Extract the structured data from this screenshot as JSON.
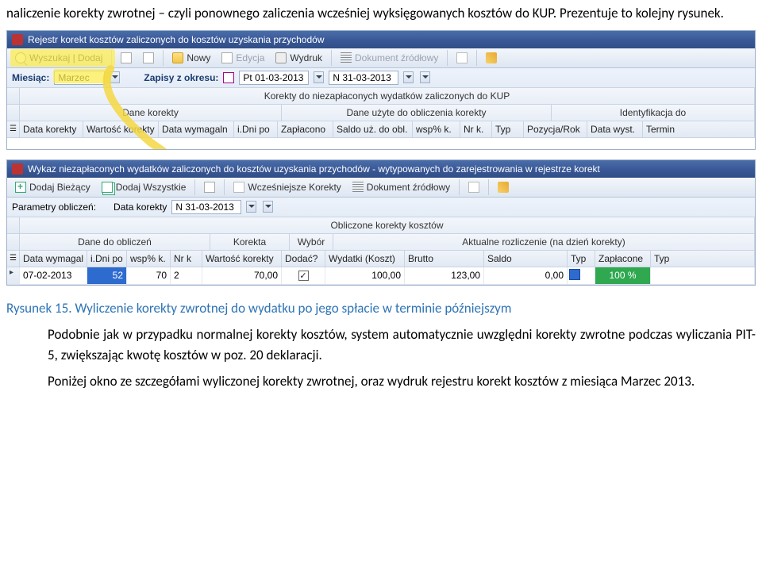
{
  "doc": {
    "para_top": "naliczenie korekty zwrotnej – czyli ponownego zaliczenia wcześniej wyksięgowanych kosztów do KUP. Prezentuje to kolejny rysunek.",
    "caption": "Rysunek 15. Wyliczenie korekty zwrotnej do wydatku po jego spłacie w terminie późniejszym",
    "para_mid": "Podobnie jak w przypadku normalnej korekty kosztów, system automatycznie uwzględni korekty zwrotne podczas wyliczania PIT-5, zwiększając kwotę kosztów w poz. 20  deklaracji.",
    "para_bot": "Poniżej okno ze szczegółami wyliczonej korekty zwrotnej, oraz wydruk rejestru korekt kosztów z miesiąca Marzec 2013."
  },
  "win1": {
    "title": "Rejestr korekt kosztów zaliczonych do kosztów uzyskania przychodów",
    "toolbar": {
      "find": "Wyszukaj | Dodaj",
      "new": "Nowy",
      "edit": "Edycja",
      "print": "Wydruk",
      "srcdoc": "Dokument źródłowy"
    },
    "params": {
      "month_label": "Miesiąc:",
      "month_value": "Marzec",
      "range_label": "Zapisy z okresu:",
      "from": "Pt 01-03-2013",
      "to": "N 31-03-2013"
    },
    "group_top": "Korekty do niezapłaconych wydatków zaliczonych do KUP",
    "groups": {
      "g1": "Dane korekty",
      "g2": "Dane użyte do obliczenia korekty",
      "g3": "Identyfikacja do"
    },
    "cols": {
      "c1": "Data korekty",
      "c2": "Wartość korekty",
      "c3": "Data wymagaln",
      "c4": "i.Dni po",
      "c5": "Zapłacono",
      "c6": "Saldo uż. do obl.",
      "c7": "wsp% k.",
      "c8": "Nr k.",
      "c9": "Typ",
      "c10": "Pozycja/Rok",
      "c11": "Data wyst.",
      "c12": "Termin"
    }
  },
  "win2": {
    "title": "Wykaz niezapłaconych wydatków zaliczonych do kosztów uzyskania przychodów - wytypowanych do zarejestrowania w rejestrze korekt",
    "toolbar": {
      "add_current": "Dodaj Bieżący",
      "add_all": "Dodaj Wszystkie",
      "prev_corr": "Wcześniejsze Korekty",
      "srcdoc": "Dokument źródłowy"
    },
    "params": {
      "label": "Parametry obliczeń:",
      "dk_label": "Data korekty",
      "dk_value": "N 31-03-2013"
    },
    "group_top": "Obliczone korekty kosztów",
    "groups": {
      "g1": "Dane do obliczeń",
      "g2": "Korekta",
      "g3": "Wybór",
      "g4": "Aktualne rozliczenie (na dzień korekty)"
    },
    "cols": {
      "c1": "Data wymagal",
      "c2": "i.Dni po",
      "c3": "wsp% k.",
      "c4": "Nr k",
      "c5": "Wartość korekty",
      "c6": "Dodać?",
      "c7": "Wydatki (Koszt)",
      "c8": "Brutto",
      "c9": "Saldo",
      "c10": "Typ",
      "c11": "Zapłacone",
      "c12": "Typ"
    },
    "row": {
      "date": "07-02-2013",
      "dni": "52",
      "wsp": "70",
      "nrk": "2",
      "wartosc": "70,00",
      "wydatki": "100,00",
      "brutto": "123,00",
      "saldo": "0,00",
      "zaplacone": "100 %"
    }
  }
}
